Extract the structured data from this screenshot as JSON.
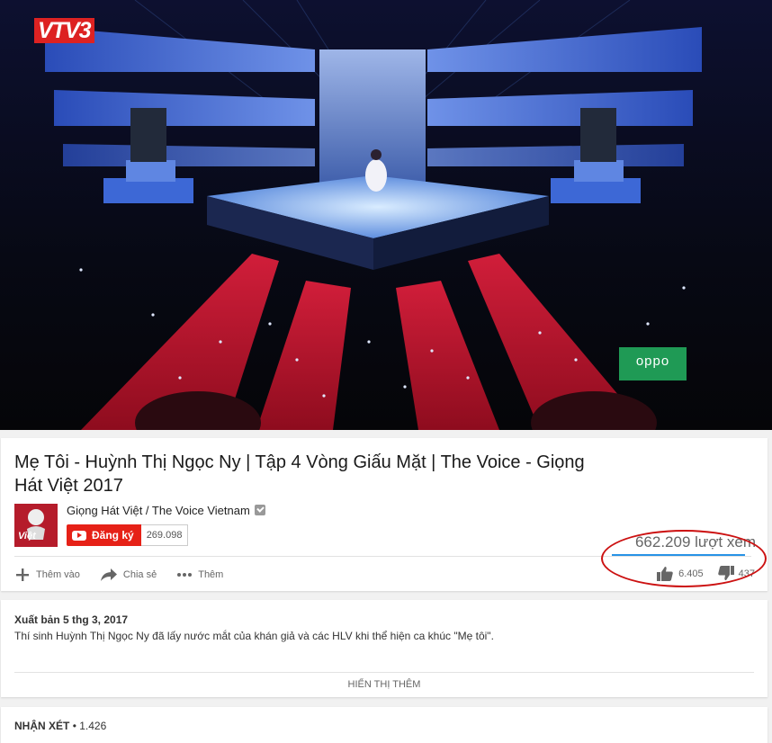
{
  "video": {
    "channel_logo": "VTV3",
    "sponsor_logo": "oppo"
  },
  "info": {
    "title": "Mẹ Tôi - Huỳnh Thị Ngọc Ny | Tập 4 Vòng Giấu Mặt | The Voice - Giọng Hát Việt 2017",
    "channel_name": "Giọng Hát Việt / The Voice Vietnam",
    "avatar_text": "Việt",
    "subscribe_label": "Đăng ký",
    "subscriber_count": "269.098",
    "views": "662.209 lượt xem",
    "like_count": "6.405",
    "dislike_count": "437",
    "actions": {
      "add_label": "Thêm vào",
      "share_label": "Chia sẻ",
      "more_label": "Thêm"
    }
  },
  "description": {
    "published": "Xuất bản 5 thg 3, 2017",
    "text": "Thí sinh Huỳnh Thị Ngọc Ny đã lấy nước mắt của khán giả và các HLV khi thể hiện ca khúc \"Mẹ tôi\".",
    "show_more_label": "HIỂN THỊ THÊM"
  },
  "comments": {
    "label": "NHẬN XÉT",
    "count": "• 1.426"
  },
  "colors": {
    "subscribe_red": "#e62117",
    "highlight_oval": "#cc1111",
    "views_bar": "#2793e6"
  }
}
